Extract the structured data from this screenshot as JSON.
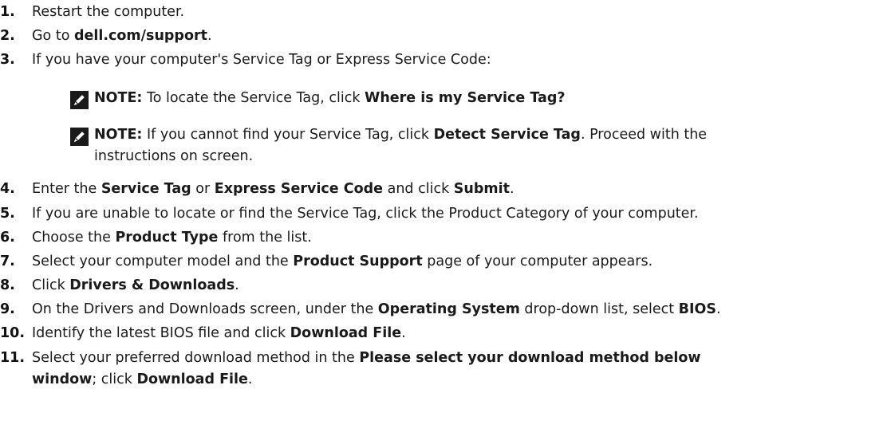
{
  "steps": [
    {
      "num": "1.",
      "parts": [
        "Restart the computer."
      ]
    },
    {
      "num": "2.",
      "parts": [
        "Go to ",
        "dell.com/support",
        "."
      ]
    },
    {
      "num": "3.",
      "parts": [
        "If you have your computer's Service Tag or Express Service Code:"
      ]
    },
    {
      "num": "4.",
      "parts": [
        "Enter the ",
        "Service Tag",
        " or ",
        "Express Service Code",
        " and click ",
        "Submit",
        "."
      ]
    },
    {
      "num": "5.",
      "parts": [
        "If you are unable to locate or find the Service Tag, click the Product Category of your computer."
      ]
    },
    {
      "num": "6.",
      "parts": [
        "Choose the ",
        "Product Type",
        " from the list."
      ]
    },
    {
      "num": "7.",
      "parts": [
        "Select your computer model and the ",
        "Product Support",
        " page of your computer appears."
      ]
    },
    {
      "num": "8.",
      "parts": [
        "Click ",
        "Drivers & Downloads",
        "."
      ]
    },
    {
      "num": "9.",
      "parts": [
        "On the Drivers and Downloads screen, under the ",
        "Operating System",
        " drop-down list, select ",
        "BIOS",
        "."
      ]
    },
    {
      "num": "10.",
      "parts": [
        "Identify the latest BIOS file and click ",
        "Download File",
        "."
      ]
    },
    {
      "num": "11.",
      "parts": [
        "Select your preferred download method in the ",
        "Please select your download method below",
        "window",
        "; click ",
        "Download File",
        "."
      ]
    }
  ],
  "notes": [
    {
      "label": "NOTE:",
      "parts": [
        " To locate the Service Tag, click ",
        "Where is my Service Tag?"
      ]
    },
    {
      "label": "NOTE:",
      "parts": [
        " If you cannot find your Service Tag, click ",
        "Detect Service Tag",
        ". Proceed with the",
        "instructions on screen."
      ]
    }
  ],
  "icons": {
    "note": "note-pencil-icon"
  },
  "colors": {
    "text": "#1a1a1a",
    "icon_bg": "#1a1a1a",
    "icon_fg": "#ffffff"
  }
}
